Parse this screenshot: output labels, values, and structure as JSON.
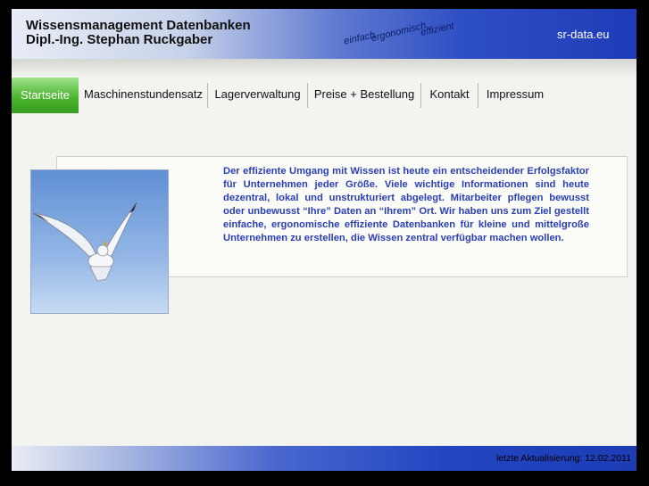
{
  "header": {
    "title_line1": "Wissensmanagement Datenbanken",
    "title_line2": "Dipl.-Ing. Stephan Ruckgaber",
    "slogan": [
      "einfach",
      "ergonomisch",
      "effizient"
    ],
    "domain": "sr-data.eu"
  },
  "nav": {
    "items": [
      {
        "label": "Startseite",
        "active": true
      },
      {
        "label": "Maschinenstundensatz",
        "active": false
      },
      {
        "label": "Lagerverwaltung",
        "active": false
      },
      {
        "label": "Preise + Bestellung",
        "active": false
      },
      {
        "label": "Kontakt",
        "active": false
      },
      {
        "label": "Impressum",
        "active": false
      }
    ]
  },
  "main": {
    "image": "seagull-photo",
    "intro_text": "Der effiziente Umgang mit Wissen ist heute ein entscheidender Erfolgsfaktor für Unternehmen jeder Größe. Viele wichtige Informationen sind heute dezentral, lokal und unstrukturiert abgelegt. Mitarbeiter pflegen bewusst oder unbewusst “Ihre” Daten an “Ihrem” Ort. Wir haben uns zum Ziel gestellt einfache, ergonomische effiziente Datenbanken für kleine und mittelgroße Unternehmen zu erstellen, die Wissen zentral verfügbar machen wollen."
  },
  "footer": {
    "last_updated": "letzte Aktualisierung: 12.02.2011"
  },
  "colors": {
    "header_blue": "#1f3cb8",
    "nav_active_green": "#47b22a",
    "intro_text_blue": "#2a3fb4"
  }
}
